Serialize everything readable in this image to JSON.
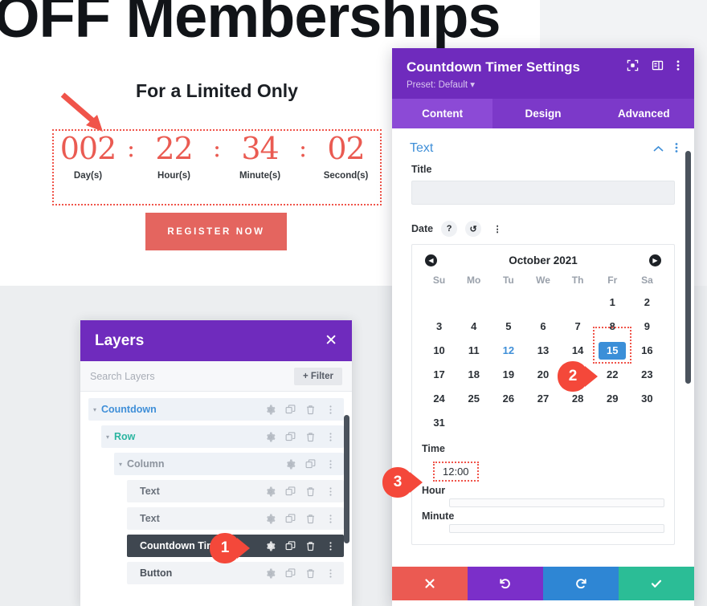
{
  "hero": {
    "title": "OFF Memberships",
    "subtitle": "For a Limited Only",
    "register_label": "REGISTER NOW"
  },
  "countdown": {
    "units": [
      {
        "value": "002",
        "label": "Day(s)"
      },
      {
        "value": "22",
        "label": "Hour(s)"
      },
      {
        "value": "34",
        "label": "Minute(s)"
      },
      {
        "value": "02",
        "label": "Second(s)"
      }
    ],
    "separator": ":",
    "accent_color": "#ea5b52"
  },
  "layers_panel": {
    "title": "Layers",
    "close_label": "✕",
    "search_placeholder": "Search Layers",
    "filter_label": "+ Filter",
    "rows": [
      {
        "name": "Countdown",
        "indent": 0,
        "color": "#3f8fd8",
        "caret": "▾",
        "selected": false,
        "has_trash": true
      },
      {
        "name": "Row",
        "indent": 1,
        "color": "#2bb5a0",
        "caret": "▾",
        "selected": false,
        "has_trash": true
      },
      {
        "name": "Column",
        "indent": 2,
        "color": "#8d949e",
        "caret": "▾",
        "selected": false,
        "has_trash": false
      },
      {
        "name": "Text",
        "indent": 3,
        "color": "#6a717b",
        "caret": "",
        "selected": false,
        "has_trash": true
      },
      {
        "name": "Text",
        "indent": 3,
        "color": "#6a717b",
        "caret": "",
        "selected": false,
        "has_trash": true
      },
      {
        "name": "Countdown Timer",
        "indent": 3,
        "color": "#ffffff",
        "caret": "",
        "selected": true,
        "has_trash": true
      },
      {
        "name": "Button",
        "indent": 3,
        "color": "#4a515a",
        "caret": "",
        "selected": false,
        "has_trash": true
      }
    ]
  },
  "settings": {
    "title": "Countdown Timer Settings",
    "preset": "Preset: Default ▾",
    "tabs": [
      {
        "label": "Content",
        "active": true
      },
      {
        "label": "Design",
        "active": false
      },
      {
        "label": "Advanced",
        "active": false
      }
    ],
    "section_title": "Text",
    "title_field": {
      "label": "Title",
      "value": "",
      "placeholder": ""
    },
    "date_field": {
      "label": "Date",
      "help": "?",
      "reset": "↺",
      "more": "⋮"
    },
    "calendar": {
      "month": "October 2021",
      "prev": "◀",
      "next": "▶",
      "dow": [
        "Su",
        "Mo",
        "Tu",
        "We",
        "Th",
        "Fr",
        "Sa"
      ],
      "lead_blanks": 5,
      "days": [
        1,
        2,
        3,
        4,
        5,
        6,
        7,
        8,
        9,
        10,
        11,
        12,
        13,
        14,
        15,
        16,
        17,
        18,
        19,
        20,
        21,
        22,
        23,
        24,
        25,
        26,
        27,
        28,
        29,
        30,
        31
      ],
      "today": 12,
      "selected": 15,
      "selected_color": "#3b8fd8",
      "today_color": "#3f8fd8"
    },
    "time": {
      "label": "Time",
      "value": "12:00"
    },
    "hour": {
      "label": "Hour",
      "value": ""
    },
    "minute": {
      "label": "Minute",
      "value": ""
    },
    "actions": [
      {
        "name": "close",
        "glyph": "✕",
        "color": "#eb5a52"
      },
      {
        "name": "undo",
        "glyph": "↺",
        "color": "#7b2fc9"
      },
      {
        "name": "redo",
        "glyph": "↻",
        "color": "#2e86d4"
      },
      {
        "name": "save",
        "glyph": "✓",
        "color": "#2bbd96"
      }
    ]
  },
  "callouts": [
    {
      "id": "1",
      "number": "1"
    },
    {
      "id": "2",
      "number": "2"
    },
    {
      "id": "3",
      "number": "3"
    }
  ],
  "colors": {
    "purple": "#6f2bbd",
    "purple_tabs": "#7c39c9",
    "annotation_red": "#f0544a",
    "callout_red": "#f4483a"
  }
}
